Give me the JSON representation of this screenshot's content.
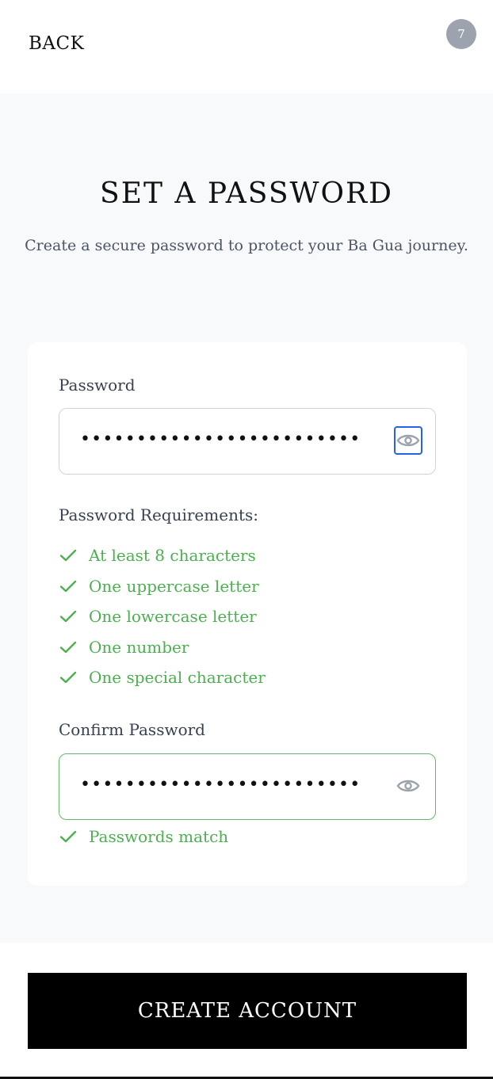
{
  "header": {
    "back_label": "BACK",
    "step_number": "7"
  },
  "page": {
    "title": "SET A PASSWORD",
    "subtitle": "Create a secure password to protect your Ba Gua journey."
  },
  "form": {
    "password": {
      "label": "Password",
      "masked_value": "•••••••••••••••••••••••••",
      "visibility_icon": "eye-icon"
    },
    "requirements": {
      "heading": "Password Requirements:",
      "items": [
        {
          "label": "At least 8 characters",
          "met": true
        },
        {
          "label": "One uppercase letter",
          "met": true
        },
        {
          "label": "One lowercase letter",
          "met": true
        },
        {
          "label": "One number",
          "met": true
        },
        {
          "label": "One special character",
          "met": true
        }
      ]
    },
    "confirm_password": {
      "label": "Confirm Password",
      "masked_value": "•••••••••••••••••••••••••",
      "visibility_icon": "eye-icon",
      "match_message": "Passwords match"
    }
  },
  "actions": {
    "create_account_label": "CREATE ACCOUNT"
  },
  "colors": {
    "success": "#4caf50",
    "focus": "#2563eb",
    "primary_button": "#000000",
    "badge": "#9ca3af"
  }
}
